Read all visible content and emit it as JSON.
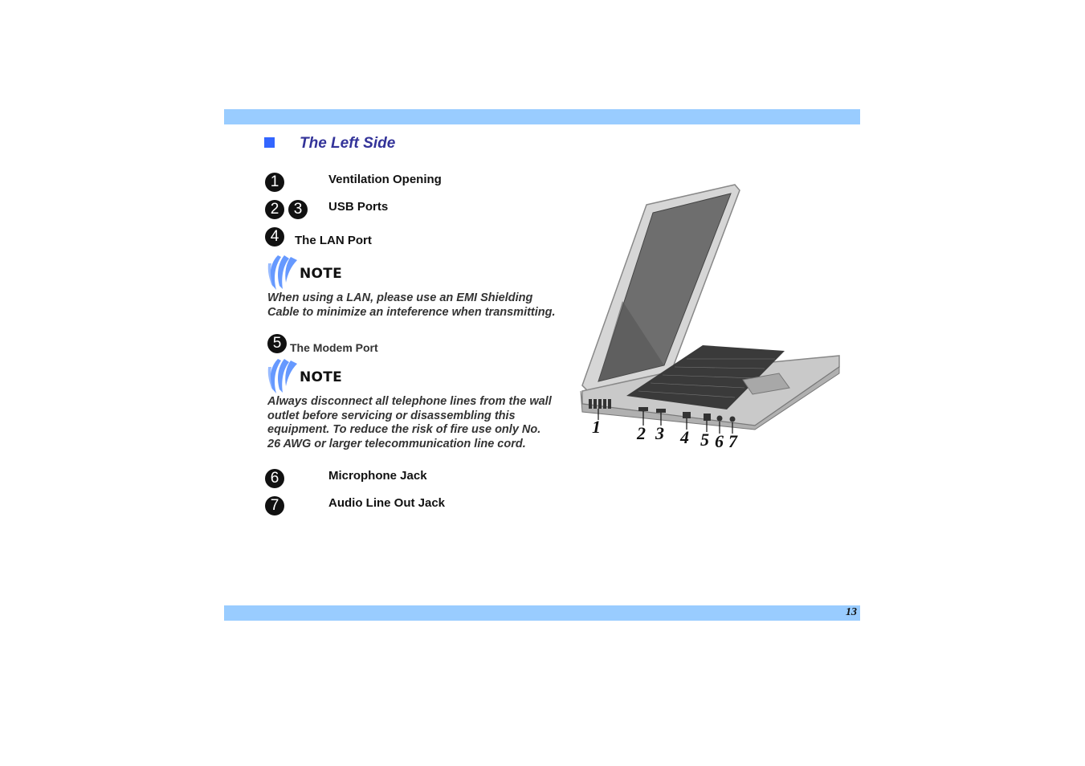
{
  "page": {
    "number": "13"
  },
  "section": {
    "title": "The Left Side"
  },
  "items": [
    {
      "numbers": [
        "1"
      ],
      "label": "Ventilation Opening"
    },
    {
      "numbers": [
        "2",
        "3"
      ],
      "label": "USB Ports"
    },
    {
      "numbers": [
        "4"
      ],
      "label": "The LAN Port"
    },
    {
      "numbers": [
        "5"
      ],
      "label": "The Modem Port"
    },
    {
      "numbers": [
        "6"
      ],
      "label": "Microphone Jack"
    },
    {
      "numbers": [
        "7"
      ],
      "label": "Audio Line Out Jack"
    }
  ],
  "notes": [
    {
      "heading": "NOTE",
      "text": "When using a LAN, please use an EMI Shielding Cable to minimize an inteference when transmitting."
    },
    {
      "heading": "NOTE",
      "text": "Always disconnect all telephone lines from the wall outlet before servicing or disassembling this equipment. To reduce the risk of fire use only No. 26 AWG or larger telecommunication line cord."
    }
  ],
  "figure": {
    "description": "Notebook computer, left side view",
    "callouts": [
      "1",
      "2",
      "3",
      "4",
      "5",
      "6",
      "7"
    ]
  },
  "colors": {
    "band": "#99ccff",
    "title": "#333399",
    "bullet": "#3366ff",
    "note_icon": "#6699ff"
  }
}
